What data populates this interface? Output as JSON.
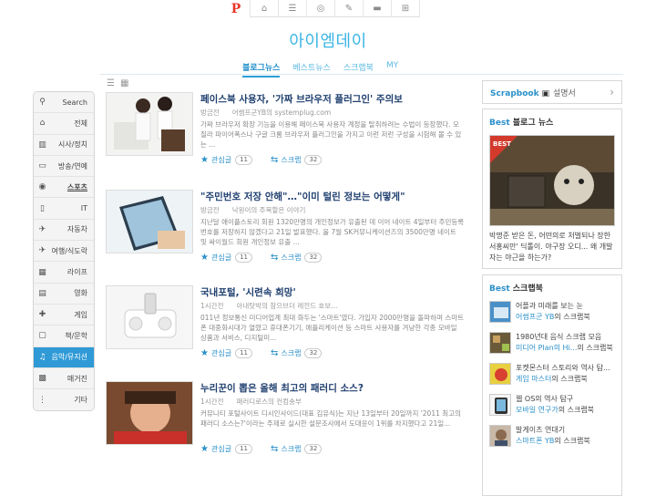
{
  "logo": "아이엠데이",
  "top_tabs": [
    {
      "name": "p-logo",
      "label": "P"
    },
    {
      "name": "home-icon",
      "label": "⌂"
    },
    {
      "name": "list-icon",
      "label": "☰"
    },
    {
      "name": "disc-icon",
      "label": "◎"
    },
    {
      "name": "pen-icon",
      "label": "✎"
    },
    {
      "name": "chat-icon",
      "label": "▬"
    },
    {
      "name": "add-icon",
      "label": "⊞"
    }
  ],
  "nav_tabs": [
    {
      "label": "블로그뉴스",
      "active": true
    },
    {
      "label": "베스트뉴스",
      "active": false
    },
    {
      "label": "스크랩북",
      "active": false
    },
    {
      "label": "MY",
      "active": false
    }
  ],
  "view_icons": [
    "☰",
    "▦"
  ],
  "sidebar": [
    {
      "icon": "search-icon",
      "glyph": "⚲",
      "label": "Search"
    },
    {
      "icon": "home-icon",
      "glyph": "⌂",
      "label": "전체"
    },
    {
      "icon": "politics-icon",
      "glyph": "▥",
      "label": "시사/정치"
    },
    {
      "icon": "tv-icon",
      "glyph": "▭",
      "label": "방송/연예"
    },
    {
      "icon": "sports-icon",
      "glyph": "◉",
      "label": "스포츠"
    },
    {
      "icon": "it-icon",
      "glyph": "▯",
      "label": "IT"
    },
    {
      "icon": "car-icon",
      "glyph": "✈",
      "label": "자동차"
    },
    {
      "icon": "travel-icon",
      "glyph": "✈",
      "label": "여행/식도락"
    },
    {
      "icon": "life-icon",
      "glyph": "▦",
      "label": "라이프"
    },
    {
      "icon": "movie-icon",
      "glyph": "▤",
      "label": "영화"
    },
    {
      "icon": "game-icon",
      "glyph": "✚",
      "label": "게임"
    },
    {
      "icon": "book-icon",
      "glyph": "▢",
      "label": "책/문학"
    },
    {
      "icon": "headphones-icon",
      "glyph": "♫",
      "label": "음악/뮤지션"
    },
    {
      "icon": "cartoon-icon",
      "glyph": "▩",
      "label": "매거진"
    },
    {
      "icon": "etc-icon",
      "glyph": "⋮",
      "label": "기타"
    }
  ],
  "articles": [
    {
      "title": "페이스북 사용자, '가짜 브라우저 플러그인' 주의보",
      "time": "방금전",
      "source": "어썸프군YB의 systemplug.com",
      "excerpt": "가짜 브라우저 확장 기능을 이용해 페이스북 사용자 계정을 탈취하려는 수법이 등장했다. 모질라 파이어폭스나 구글 크롬 브라우저 플러그인을 가지고 이런 저런 구성을 시험해 볼 수 있는 ...",
      "like_label": "관심글",
      "like_count": "11",
      "scrap_label": "스크랩",
      "scrap_count": "32"
    },
    {
      "title": "\"주민번호 저장 안해\"…\"이미 털린 정보는 어떻게\"",
      "time": "방금전",
      "source": "낙원이의 주목할은 이야기",
      "excerpt": "지난달 애이플스토리 회원 1320만명의 개인정보가 유출된 데 이어 네이트 4일부터 주민등록번호를 저장하지 않겠다고 21일 발표했다. 올 7월 SK커뮤니케이션즈의 3500만명 네이트 및 싸이월드 회원 개인정보 유출 ...",
      "like_label": "관심글",
      "like_count": "11",
      "scrap_label": "스크랩",
      "scrap_count": "32"
    },
    {
      "title": "국내포털, '시련속 희망'",
      "time": "1시간전",
      "source": "아내탓박의 참으브더 레전드 호보...",
      "excerpt": "011년 정보통신 미디어업계 최대 화두는 '스마트'였다. 가입자 2000만명을 돌파하며 스마트폰 대중화시대가 열렸고 휴대폰기기, 애플리케이션 등 스마트 사용자를 겨냥한 각종 모바일 상품과 서비스, 디지털미...",
      "like_label": "관심글",
      "like_count": "11",
      "scrap_label": "스크랩",
      "scrap_count": "32"
    },
    {
      "title": "누리꾼이 뽑은 올해 최고의 패러디 소스?",
      "time": "1시간전",
      "source": "패러디로스의 컨컴송부",
      "excerpt": "커뮤니티 포털사이트 디시인사이드(대표 김유식)는 지난 13일부터 20일까지 '2011 최고의 패러디 소스는?'이라는 주제로 실시한 설문조사에서 도대윤이 1위를 차지했다고 21일...",
      "like_label": "관심글",
      "like_count": "11",
      "scrap_label": "스크랩",
      "scrap_count": "32"
    }
  ],
  "scrapbook": {
    "title": "Scrapbook",
    "desc": "설명서"
  },
  "best_news": {
    "heading_best": "Best",
    "heading_rest": " 블로그 뉴스",
    "badge": "BEST",
    "text": "박명준 받은 돈, 어떤의로 처벌되나 장한 서홍씨만' 딕톨이. 야구장 오디... 왜 개발자는 야근을 하는가?"
  },
  "best_scrap": {
    "heading_best": "Best",
    "heading_rest": " 스크랩북",
    "items": [
      {
        "line1": "어플과 미래를 보는 눈",
        "owner": "어썸프군 YB",
        "suffix": "의 스크랩북"
      },
      {
        "line1": "1980년대 음식 스크랩 모음",
        "owner": "미디어 Plan의 Hi...",
        "suffix": "의 스크랩북"
      },
      {
        "line1": "포켓몬스터 스토리와 역사 탐...",
        "owner": "게임 마스터",
        "suffix": "의 스크랩북"
      },
      {
        "line1": "웹 OS의 역사 탐구",
        "owner": "모바일 연구가",
        "suffix": "의 스크랩북"
      },
      {
        "line1": "발게이츠 연대기",
        "owner": "스마트폰 YB",
        "suffix": "의 스크랩북"
      }
    ]
  },
  "colors": {
    "accent": "#2a8fc8",
    "logo": "#3bb5e5",
    "active_category": "#2f9ad6"
  }
}
